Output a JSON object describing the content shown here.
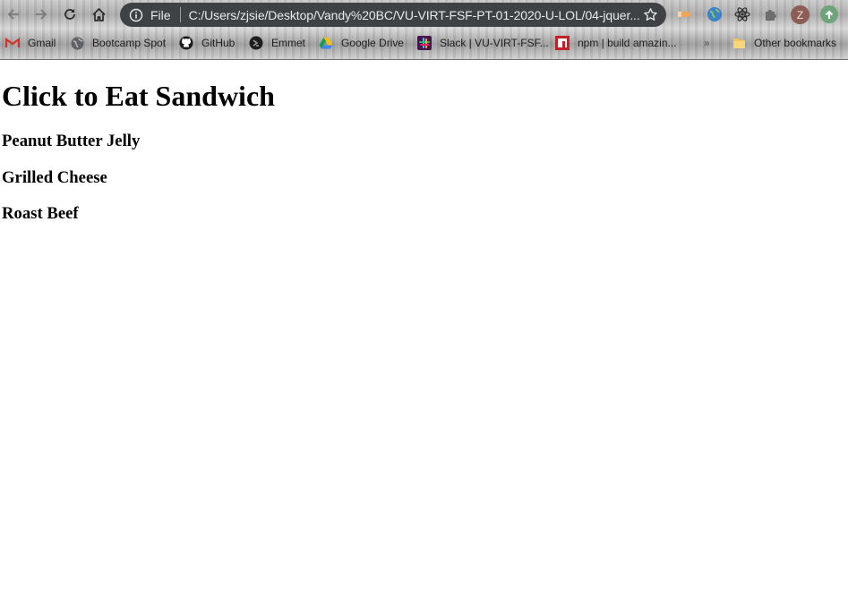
{
  "browser": {
    "omnibox": {
      "scheme_label": "File",
      "url": "C:/Users/zjsie/Desktop/Vandy%20BC/VU-VIRT-FSF-PT-01-2020-U-LOL/04-jquer..."
    },
    "profile_initial": "Z",
    "bookmarks": [
      {
        "label": "Gmail",
        "icon": "gmail-icon"
      },
      {
        "label": "Bootcamp Spot",
        "icon": "globe-icon"
      },
      {
        "label": "GitHub",
        "icon": "github-icon"
      },
      {
        "label": "Emmet",
        "icon": "emmet-icon"
      },
      {
        "label": "Google Drive",
        "icon": "google-drive-icon"
      },
      {
        "label": "Slack | VU-VIRT-FSF...",
        "icon": "slack-icon"
      },
      {
        "label": "npm | build amazin...",
        "icon": "npm-icon"
      },
      {
        "label": "Other bookmarks",
        "icon": "folder-icon"
      }
    ],
    "more_bookmarks": "»"
  },
  "page": {
    "title": "Click to Eat Sandwich",
    "sandwiches": [
      "Peanut Butter Jelly",
      "Grilled Cheese",
      "Roast Beef"
    ]
  },
  "colors": {
    "omnibox_bg": "#3f4245",
    "page_bg": "#ffffff",
    "text": "#000000"
  }
}
